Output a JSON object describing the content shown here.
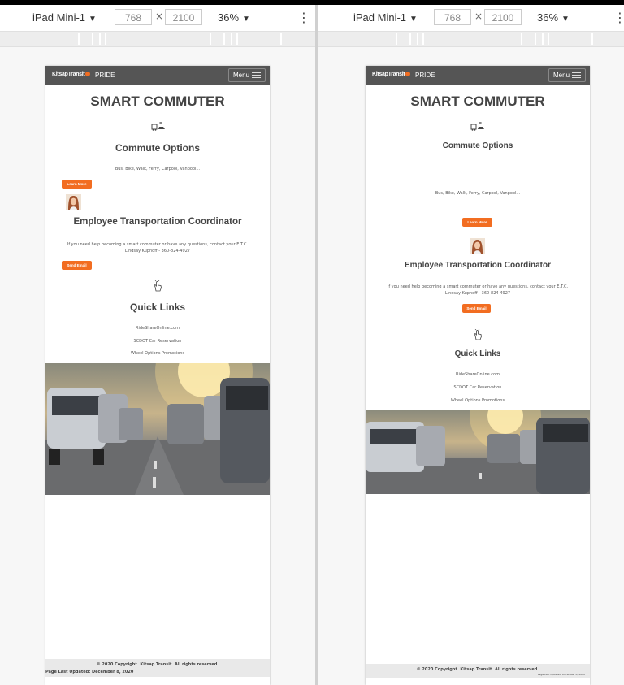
{
  "devtools": {
    "device_label": "iPad Mini-1",
    "width_value": "768",
    "height_value": "2100",
    "times_symbol": "×",
    "zoom_label": "36%",
    "caret": "▼",
    "more": "⋮"
  },
  "site": {
    "logo_text": "KitsapTransit",
    "nav_label": "PRIDE",
    "menu_label": "Menu",
    "page_title": "SMART COMMUTER",
    "commute": {
      "heading": "Commute Options",
      "text": "Bus, Bike, Walk, Ferry, Carpool, Vanpool...",
      "button": "Learn More"
    },
    "etc": {
      "heading": "Employee Transportation Coordinator",
      "text": "If you need help becoming a smart commuter or have any questions, contact your E.T.C. Lindsay Kuphoff - 360-824-4927",
      "button": "Send Email"
    },
    "quick": {
      "heading": "Quick Links",
      "links": [
        "RideShareOnline.com",
        "SCDOT Car Reservation",
        "Wheel Options Promotions"
      ]
    },
    "footer": {
      "copyright": "© 2020 Copyright. Kitsap Transit. All rights reserved.",
      "updated": "Page Last Updated: December 8, 2020"
    }
  },
  "colors": {
    "accent": "#f26d21",
    "navbar": "#555555"
  }
}
